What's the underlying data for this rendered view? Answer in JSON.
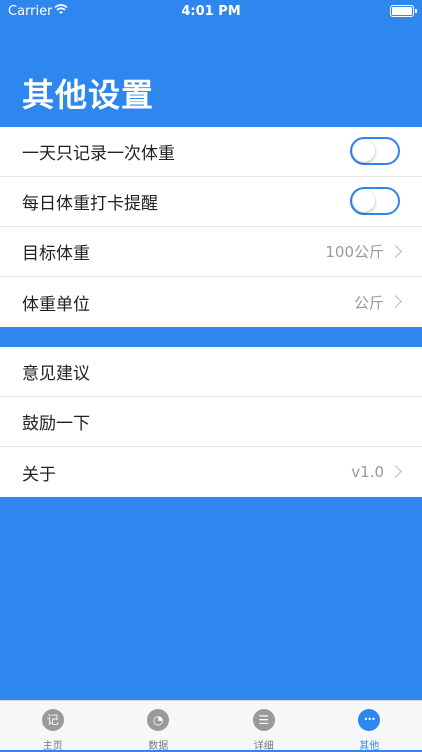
{
  "status": {
    "carrier": "Carrier",
    "time": "4:01 PM"
  },
  "header": {
    "title": "其他设置"
  },
  "settings_group1": [
    {
      "label": "一天只记录一次体重",
      "control": "toggle",
      "on": false
    },
    {
      "label": "每日体重打卡提醒",
      "control": "toggle",
      "on": false
    },
    {
      "label": "目标体重",
      "value": "100公斤"
    },
    {
      "label": "体重单位",
      "value": "公斤"
    }
  ],
  "settings_group2": [
    {
      "label": "意见建议"
    },
    {
      "label": "鼓励一下"
    },
    {
      "label": "关于",
      "value": "v1.0"
    }
  ],
  "tabbar": {
    "items": [
      {
        "label": "主页",
        "icon": "record-icon",
        "glyph": "记"
      },
      {
        "label": "数据",
        "icon": "pie-chart-icon",
        "glyph": "◔"
      },
      {
        "label": "详细",
        "icon": "list-icon",
        "glyph": "☰"
      },
      {
        "label": "其他",
        "icon": "more-icon",
        "glyph": "•••"
      }
    ],
    "active_index": 3
  },
  "colors": {
    "accent": "#2e87ee"
  }
}
